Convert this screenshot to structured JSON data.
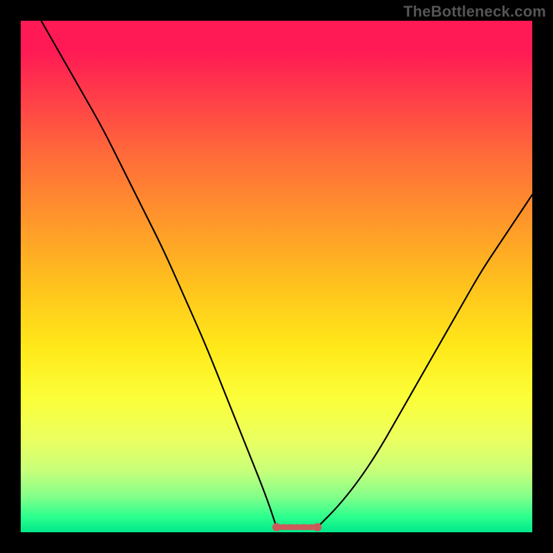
{
  "watermark": "TheBottleneck.com",
  "chart_data": {
    "type": "line",
    "title": "",
    "xlabel": "",
    "ylabel": "",
    "xlim": [
      0,
      100
    ],
    "ylim": [
      0,
      100
    ],
    "grid": false,
    "legend": false,
    "left_curve": {
      "x": [
        4,
        8,
        12,
        16,
        20,
        24,
        28,
        32,
        36,
        40,
        44,
        48,
        50
      ],
      "y": [
        100,
        93,
        86,
        79,
        71,
        63,
        55,
        46,
        37,
        27,
        17,
        7,
        1
      ]
    },
    "right_curve": {
      "x": [
        58,
        62,
        66,
        70,
        74,
        78,
        82,
        86,
        90,
        94,
        98,
        100
      ],
      "y": [
        1,
        5,
        10,
        16,
        23,
        30,
        37,
        44,
        51,
        57,
        63,
        66
      ]
    },
    "flat_segment": {
      "x_start": 50,
      "x_end": 58,
      "y": 1
    },
    "gradient_stops": [
      {
        "pos": 0.0,
        "color": "#ff1a55"
      },
      {
        "pos": 0.3,
        "color": "#ff8a2a"
      },
      {
        "pos": 0.55,
        "color": "#ffd81a"
      },
      {
        "pos": 0.8,
        "color": "#f1ff4a"
      },
      {
        "pos": 0.95,
        "color": "#5aff8a"
      },
      {
        "pos": 1.0,
        "color": "#00e88a"
      }
    ],
    "highlight_color": "#cc5a5a"
  }
}
